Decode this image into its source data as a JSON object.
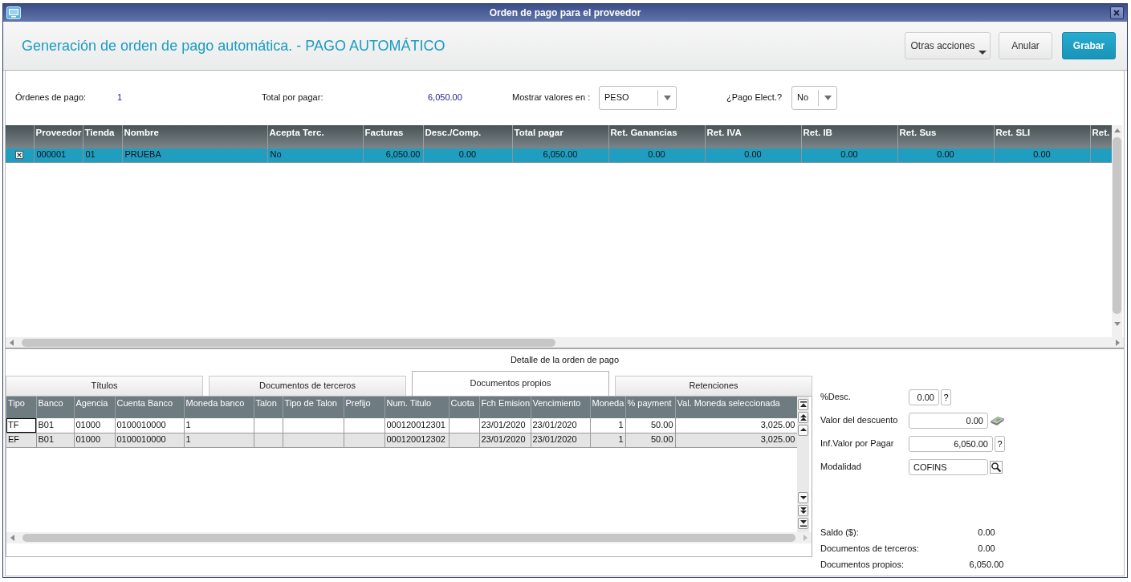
{
  "window": {
    "title": "Orden de pago para el proveedor"
  },
  "header": {
    "title": "Generación de orden de pago automática. - PAGO AUTOMÁTICO",
    "buttons": [
      {
        "label": "Otras acciones",
        "kind": "menu"
      },
      {
        "label": "Anular",
        "kind": "plain"
      },
      {
        "label": "Grabar",
        "kind": "primary"
      }
    ]
  },
  "summary": {
    "orders": {
      "label": "Órdenes de pago:",
      "value": "1"
    },
    "total": {
      "label": "Total por pagar:",
      "value": "6,050.00"
    },
    "currency": {
      "label": "Mostrar valores en :",
      "value": "PESO"
    },
    "electronic_payment": {
      "label": "¿Pago Elect.?",
      "value": "No"
    }
  },
  "suppliers_table": {
    "columns": [
      "Proveedor",
      "Tienda",
      "Nombre",
      "Acepta Terc.",
      "Facturas",
      "Desc./Comp.",
      "Total pagar",
      "Ret. Ganancias",
      "Ret. IVA",
      "Ret. IB",
      "Ret. Sus",
      "Ret. SLI",
      "Ret."
    ],
    "rows": [
      {
        "checked": true,
        "selected": true,
        "cells": [
          "000001",
          "01",
          "PRUEBA",
          "No",
          "6,050.00",
          "0.00",
          "6,050.00",
          "0.00",
          "0.00",
          "0.00",
          "0.00",
          "0.00",
          null
        ]
      }
    ]
  },
  "detail": {
    "title": "Detalle de la orden de pago",
    "tabs": [
      {
        "label": "Títulos",
        "selected": false
      },
      {
        "label": "Documentos de terceros",
        "selected": false
      },
      {
        "label": "Documentos propios",
        "selected": true
      },
      {
        "label": "Retenciones",
        "selected": false
      }
    ],
    "table": {
      "columns": [
        "Tipo",
        "Banco",
        "Agencia",
        "Cuenta Banco",
        "Moneda banco",
        "Talon",
        "Tipo de Talon",
        "Prefijo",
        "Num. Titulo",
        "Cuota",
        "Fch Emision",
        "Vencimiento",
        "Moneda",
        "% payment",
        "Val. Moneda seleccionada"
      ],
      "rows": [
        {
          "selected": true,
          "cells": [
            "TF",
            "B01",
            "01000",
            "0100010000",
            "1",
            null,
            null,
            null,
            "000120012301",
            null,
            "23/01/2020",
            "23/01/2020",
            "1",
            "50.00",
            "3,025.00"
          ]
        },
        {
          "selected": false,
          "cells": [
            "EF",
            "B01",
            "01000",
            "0100010000",
            "1",
            null,
            null,
            null,
            "000120012302",
            null,
            "23/01/2020",
            "23/01/2020",
            "1",
            "50.00",
            "3,025.00"
          ]
        }
      ]
    }
  },
  "side_panel": {
    "fields": [
      {
        "label": "%Desc.",
        "value": "0.00",
        "kind": "help",
        "button": "?"
      },
      {
        "label": "Valor del descuento",
        "value": "0.00",
        "kind": "money"
      },
      {
        "label": "Inf.Valor por Pagar",
        "value": "6,050.00",
        "kind": "help",
        "button": "?"
      },
      {
        "label": "Modalidad",
        "value": "COFINS",
        "kind": "lookup"
      }
    ],
    "totals": [
      {
        "label": "Saldo ($):",
        "value": "0.00"
      },
      {
        "label": "Documentos de terceros:",
        "value": "0.00"
      },
      {
        "label": "Documentos propios:",
        "value": "6,050.00"
      }
    ]
  }
}
